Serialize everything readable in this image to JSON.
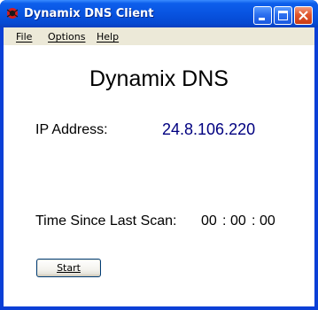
{
  "window": {
    "title": "Dynamix DNS Client",
    "icon": "dynamix-app-icon",
    "controls": [
      "minimize-icon",
      "maximize-icon",
      "close-icon"
    ]
  },
  "menu": {
    "items": [
      {
        "label": "File"
      },
      {
        "label": "Options"
      },
      {
        "label": "Help"
      }
    ]
  },
  "main": {
    "heading": "Dynamix DNS",
    "ip_label": "IP Address:",
    "ip_value": "24.8.106.220",
    "time_label": "Time Since Last Scan:",
    "timer": {
      "hours": "00",
      "sep1": ":",
      "minutes": "00",
      "sep2": ":",
      "seconds": "00"
    },
    "start_label": "Start"
  },
  "colors": {
    "titlebar": "#0853e0",
    "ip_value": "#000080",
    "menubar": "#ece9d8"
  }
}
